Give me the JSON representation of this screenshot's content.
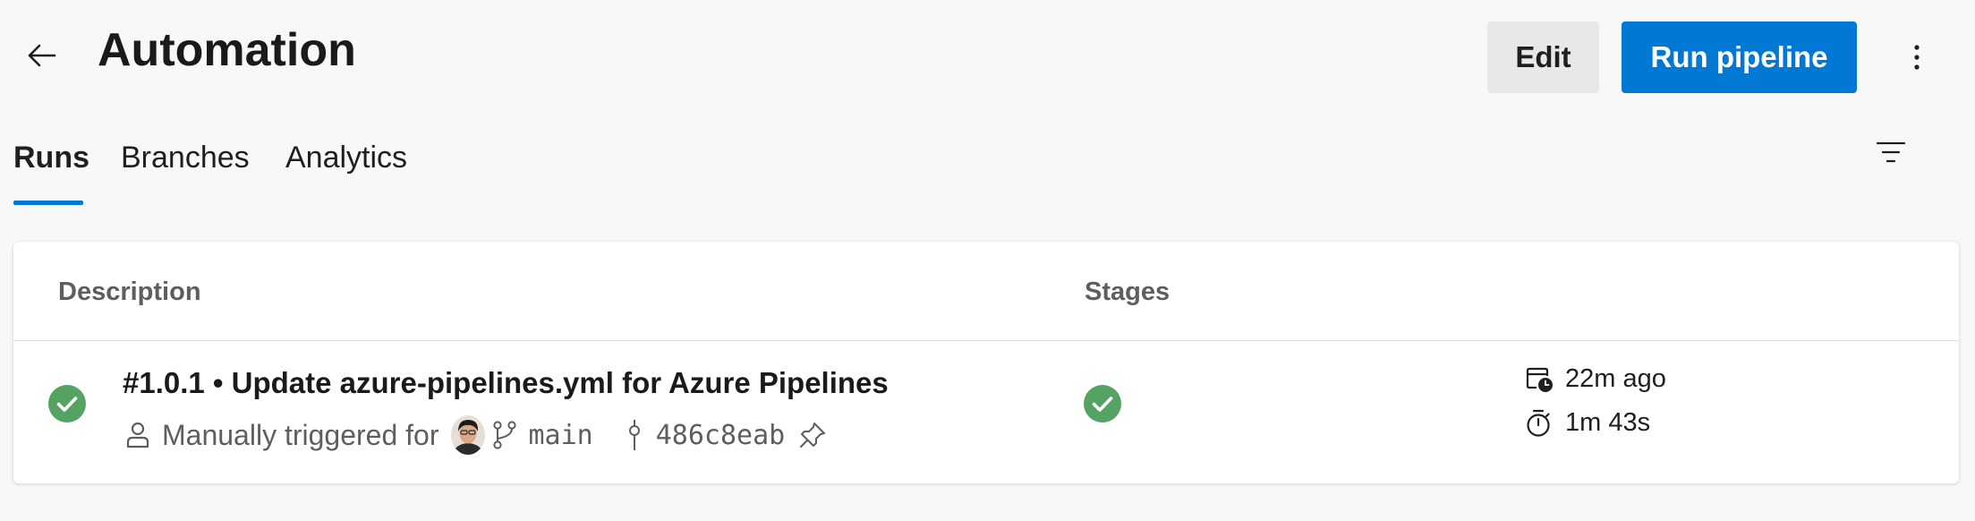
{
  "header": {
    "title": "Automation",
    "back_icon": "arrow-left-icon",
    "edit_label": "Edit",
    "run_label": "Run pipeline",
    "more_icon": "more-vertical-icon"
  },
  "tabs": [
    {
      "label": "Runs",
      "active": true
    },
    {
      "label": "Branches",
      "active": false
    },
    {
      "label": "Analytics",
      "active": false
    }
  ],
  "filter_icon": "filter-icon",
  "table": {
    "columns": [
      "Description",
      "Stages"
    ],
    "runs": [
      {
        "status": "succeeded",
        "title": "#1.0.1 • Update azure-pipelines.yml for Azure Pipelines",
        "trigger_text": "Manually triggered for",
        "branch": "main",
        "commit": "486c8eab",
        "stage_status": "succeeded",
        "queued": "22m ago",
        "duration": "1m 43s"
      }
    ]
  },
  "colors": {
    "accent": "#0078d4",
    "success": "#55a362",
    "text_secondary": "#605e5c"
  }
}
